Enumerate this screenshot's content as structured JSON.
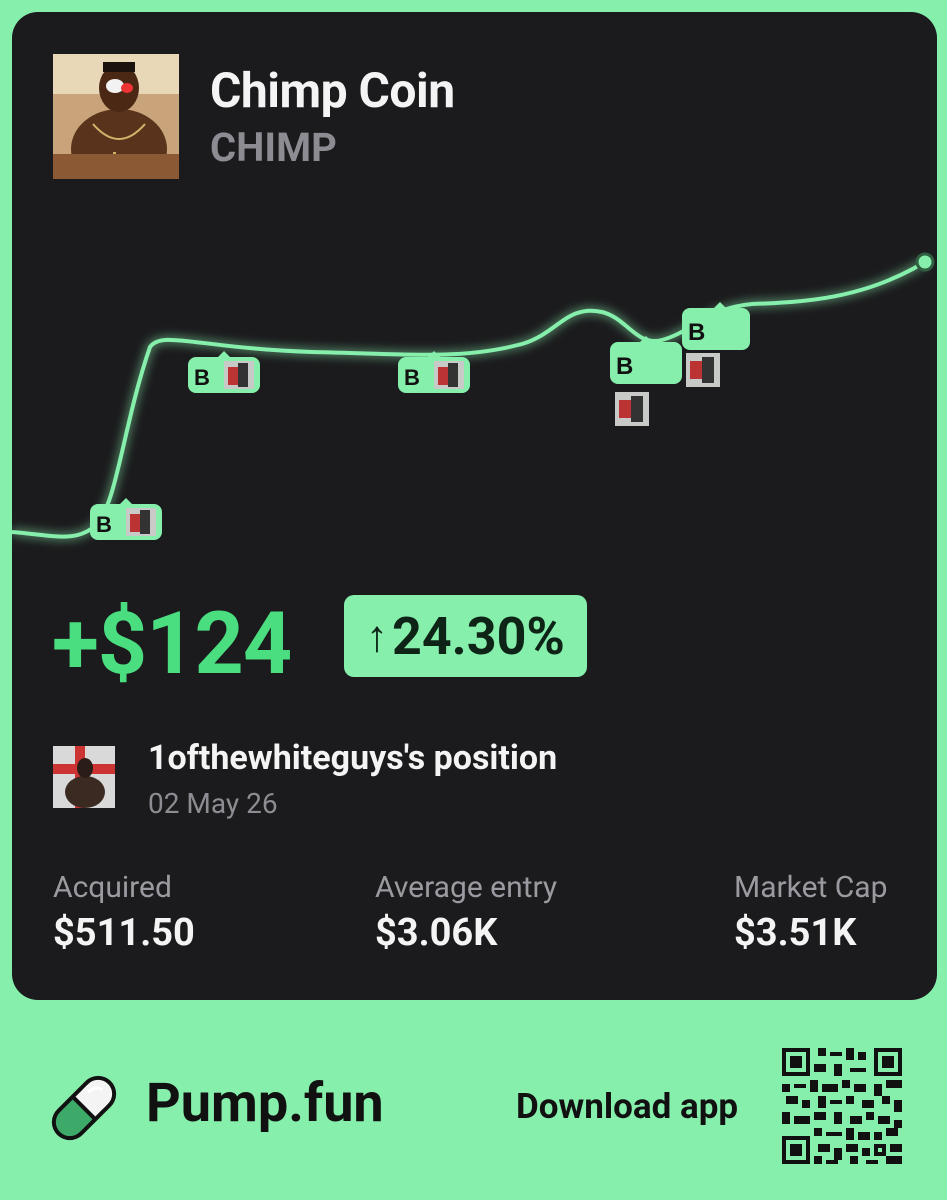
{
  "token": {
    "name": "Chimp Coin",
    "symbol": "CHIMP"
  },
  "chart": {
    "marker_label": "B",
    "line_color": "#86efac"
  },
  "pnl": {
    "amount": "+$124",
    "percent": "24.30%",
    "direction": "up"
  },
  "holder": {
    "title": "1ofthewhiteguys's position",
    "date": "02 May 26"
  },
  "stats": {
    "acquired_label": "Acquired",
    "acquired_value": "$511.50",
    "avg_entry_label": "Average entry",
    "avg_entry_value": "$3.06K",
    "market_cap_label": "Market Cap",
    "market_cap_value": "$3.51K"
  },
  "footer": {
    "brand": "Pump.fun",
    "download": "Download app"
  },
  "colors": {
    "background": "#86efac",
    "card": "#1b1b1d",
    "positive": "#4ade80",
    "badge": "#86efac"
  }
}
